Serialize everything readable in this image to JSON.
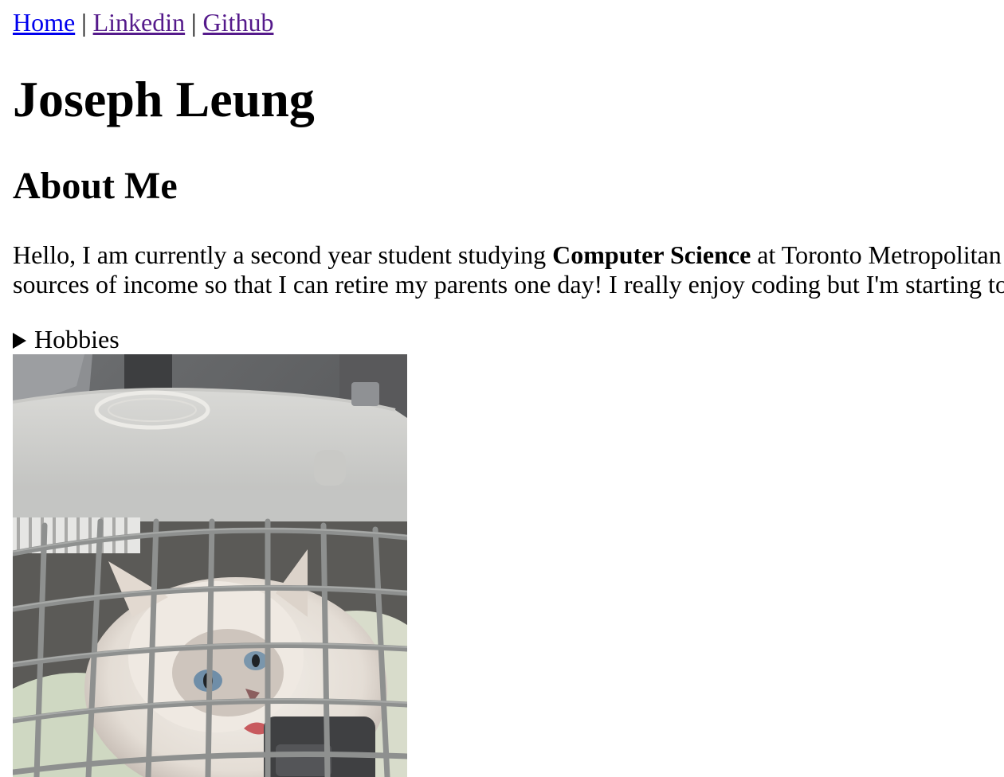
{
  "nav": {
    "home_label": "Home",
    "separator": "|",
    "linkedin_label": "Linkedin",
    "github_label": "Github"
  },
  "header": {
    "name": "Joseph Leung"
  },
  "about": {
    "heading": "About Me",
    "bio_part1": "Hello, I am currently a second year student studying ",
    "bio_bold": "Computer Science",
    "bio_part2": " at Toronto Metropolitan",
    "bio_line2": "sources of income so that I can retire my parents one day! I really enjoy coding but I'm starting to"
  },
  "hobbies": {
    "summary_label": "Hobbies"
  },
  "photo": {
    "alt": "cat in carrier"
  },
  "colors": {
    "link_unvisited": "#0000ee",
    "link_visited": "#551a8b",
    "text": "#000000",
    "background": "#ffffff"
  }
}
